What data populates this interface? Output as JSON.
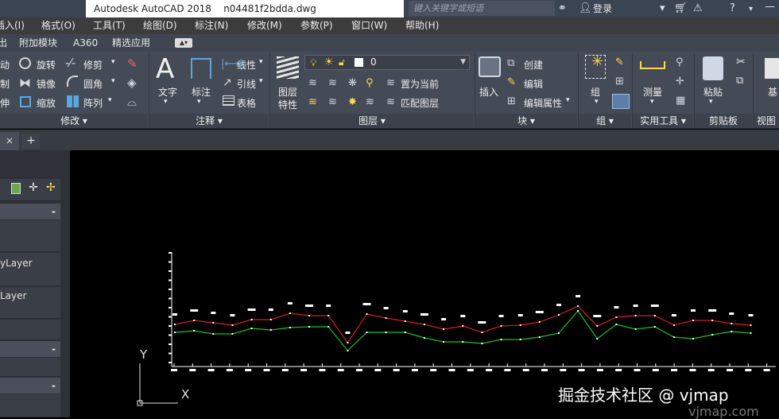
{
  "titlebar": {
    "app_name": "Autodesk AutoCAD 2018",
    "filename": "n04481f2bdda.dwg",
    "search_placeholder": "键入关键字或短语",
    "login_label": "登录"
  },
  "menubar": {
    "items": [
      "插入(I)",
      "格式(O)",
      "工具(T)",
      "绘图(D)",
      "标注(N)",
      "修改(M)",
      "参数(P)",
      "窗口(W)",
      "帮助(H)"
    ]
  },
  "ribbon_tabs": {
    "items": [
      "出",
      "附加模块",
      "A360",
      "精选应用"
    ]
  },
  "ribbon": {
    "modify": {
      "col1": [
        "动",
        "制",
        "伸"
      ],
      "col2": [
        "旋转",
        "镜像",
        "缩放"
      ],
      "col3": [
        "修剪",
        "圆角",
        "阵列"
      ],
      "title": "修改"
    },
    "annotation": {
      "text_label": "文字",
      "dim_label": "标注",
      "linear_label": "线性",
      "leader_label": "引线",
      "table_label": "表格",
      "title": "注释"
    },
    "layers": {
      "props_label_1": "图层",
      "props_label_2": "特性",
      "current_layer": "0",
      "set_current": "置为当前",
      "match_layer": "匹配图层",
      "title": "图层"
    },
    "block": {
      "insert_label": "插入",
      "create_label": "创建",
      "edit_label": "编辑",
      "edit_attr_label": "编辑属性",
      "title": "块"
    },
    "group": {
      "group_label": "组",
      "title": "组"
    },
    "utilities": {
      "measure_label": "测量",
      "title": "实用工具"
    },
    "clipboard": {
      "paste_label": "粘贴",
      "title": "剪贴板"
    },
    "view": {
      "base_label": "基",
      "title": "视图"
    }
  },
  "doc_tabs": {
    "close_symbol": "×",
    "new_tab_symbol": "+"
  },
  "palette": {
    "layer_rows": [
      "yLayer",
      "Layer"
    ],
    "collapse_symbol": "-"
  },
  "drawing": {
    "ucs_x": "X",
    "ucs_y": "Y",
    "watermark": "掘金技术社区 @ vjmap",
    "watermark_sub": "vjmap.com",
    "colors": {
      "red_line": "#d22020",
      "green_line": "#1fbf1f",
      "axis": "#ffffff"
    }
  }
}
